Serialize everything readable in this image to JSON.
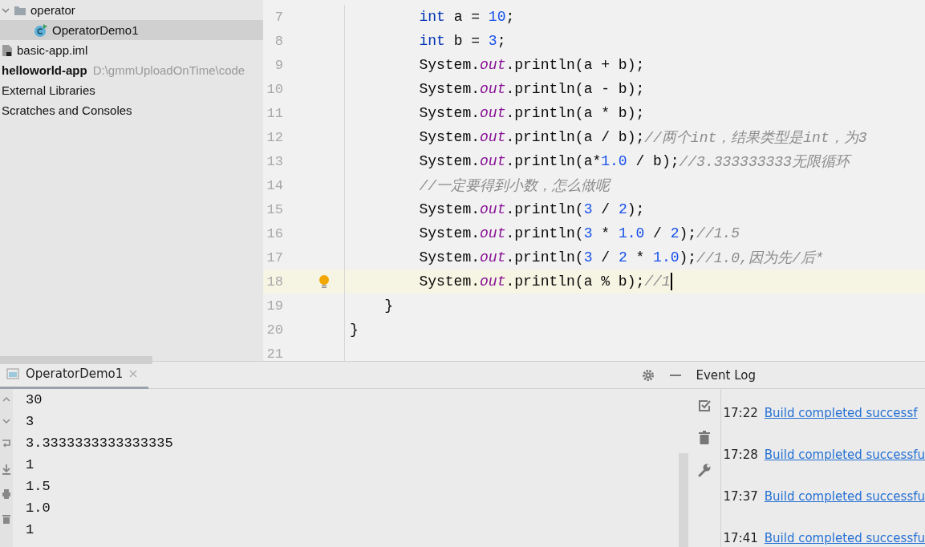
{
  "project_tree": [
    {
      "label": "operator",
      "kind": "folder",
      "expanded": true,
      "selected": false,
      "children": [
        {
          "label": "OperatorDemo1",
          "kind": "class",
          "selected": true
        }
      ]
    },
    {
      "label": "basic-app.iml",
      "kind": "file",
      "selected": false
    },
    {
      "label": "helloworld-app",
      "kind": "module",
      "bold": true,
      "path": "D:\\gmmUploadOnTime\\code",
      "selected": false
    },
    {
      "label": "External Libraries",
      "kind": "plain",
      "selected": false
    },
    {
      "label": "Scratches and Consoles",
      "kind": "plain",
      "selected": false
    }
  ],
  "editor": {
    "lines": [
      {
        "number": "7",
        "current": false,
        "tokens": [
          {
            "kind": "keyword",
            "text": "        int"
          },
          {
            "kind": "plain",
            "text": " a = "
          },
          {
            "kind": "number",
            "text": "10"
          },
          {
            "kind": "plain",
            "text": ";"
          }
        ]
      },
      {
        "number": "8",
        "current": false,
        "tokens": [
          {
            "kind": "keyword",
            "text": "        int"
          },
          {
            "kind": "plain",
            "text": " b = "
          },
          {
            "kind": "number",
            "text": "3"
          },
          {
            "kind": "plain",
            "text": ";"
          }
        ]
      },
      {
        "number": "9",
        "current": false,
        "tokens": [
          {
            "kind": "plain",
            "text": "        System."
          },
          {
            "kind": "field",
            "text": "out"
          },
          {
            "kind": "plain",
            "text": ".println(a + b);"
          }
        ]
      },
      {
        "number": "10",
        "current": false,
        "tokens": [
          {
            "kind": "plain",
            "text": "        System."
          },
          {
            "kind": "field",
            "text": "out"
          },
          {
            "kind": "plain",
            "text": ".println(a - b);"
          }
        ]
      },
      {
        "number": "11",
        "current": false,
        "tokens": [
          {
            "kind": "plain",
            "text": "        System."
          },
          {
            "kind": "field",
            "text": "out"
          },
          {
            "kind": "plain",
            "text": ".println(a * b);"
          }
        ]
      },
      {
        "number": "12",
        "current": false,
        "tokens": [
          {
            "kind": "plain",
            "text": "        System."
          },
          {
            "kind": "field",
            "text": "out"
          },
          {
            "kind": "plain",
            "text": ".println(a / b);"
          },
          {
            "kind": "comment",
            "text": "//两个int，结果类型是int，为3"
          }
        ]
      },
      {
        "number": "13",
        "current": false,
        "tokens": [
          {
            "kind": "plain",
            "text": "        System."
          },
          {
            "kind": "field",
            "text": "out"
          },
          {
            "kind": "plain",
            "text": ".println(a*"
          },
          {
            "kind": "number",
            "text": "1.0"
          },
          {
            "kind": "plain",
            "text": " / b);"
          },
          {
            "kind": "comment",
            "text": "//3.333333333无限循环"
          }
        ]
      },
      {
        "number": "14",
        "current": false,
        "tokens": [
          {
            "kind": "comment",
            "text": "        //一定要得到小数，怎么做呢"
          }
        ]
      },
      {
        "number": "15",
        "current": false,
        "tokens": [
          {
            "kind": "plain",
            "text": "        System."
          },
          {
            "kind": "field",
            "text": "out"
          },
          {
            "kind": "plain",
            "text": ".println("
          },
          {
            "kind": "number",
            "text": "3"
          },
          {
            "kind": "plain",
            "text": " / "
          },
          {
            "kind": "number",
            "text": "2"
          },
          {
            "kind": "plain",
            "text": ");"
          }
        ]
      },
      {
        "number": "16",
        "current": false,
        "tokens": [
          {
            "kind": "plain",
            "text": "        System."
          },
          {
            "kind": "field",
            "text": "out"
          },
          {
            "kind": "plain",
            "text": ".println("
          },
          {
            "kind": "number",
            "text": "3"
          },
          {
            "kind": "plain",
            "text": " * "
          },
          {
            "kind": "number",
            "text": "1.0"
          },
          {
            "kind": "plain",
            "text": " / "
          },
          {
            "kind": "number",
            "text": "2"
          },
          {
            "kind": "plain",
            "text": ");"
          },
          {
            "kind": "comment",
            "text": "//1.5"
          }
        ]
      },
      {
        "number": "17",
        "current": false,
        "tokens": [
          {
            "kind": "plain",
            "text": "        System."
          },
          {
            "kind": "field",
            "text": "out"
          },
          {
            "kind": "plain",
            "text": ".println("
          },
          {
            "kind": "number",
            "text": "3"
          },
          {
            "kind": "plain",
            "text": " / "
          },
          {
            "kind": "number",
            "text": "2"
          },
          {
            "kind": "plain",
            "text": " * "
          },
          {
            "kind": "number",
            "text": "1.0"
          },
          {
            "kind": "plain",
            "text": ");"
          },
          {
            "kind": "comment",
            "text": "//1.0,因为先/后*"
          }
        ]
      },
      {
        "number": "18",
        "current": true,
        "tokens": [
          {
            "kind": "plain",
            "text": "        System."
          },
          {
            "kind": "field",
            "text": "out"
          },
          {
            "kind": "plain",
            "text": ".println(a % b);"
          },
          {
            "kind": "comment",
            "text": "//1"
          }
        ]
      },
      {
        "number": "19",
        "current": false,
        "tokens": [
          {
            "kind": "plain",
            "text": "    }"
          }
        ]
      },
      {
        "number": "20",
        "current": false,
        "tokens": [
          {
            "kind": "plain",
            "text": "}"
          }
        ]
      },
      {
        "number": "21",
        "current": false
      }
    ]
  },
  "run_panel": {
    "tab": {
      "label": "OperatorDemo1",
      "selected": true
    },
    "output": [
      "30",
      "3",
      "3.3333333333333335",
      "1",
      "1.5",
      "1.0",
      "1"
    ]
  },
  "event_log": {
    "title": "Event Log",
    "entries": [
      {
        "time": "17:22",
        "message": "Build completed successf"
      },
      {
        "time": "17:28",
        "message": "Build completed successfu"
      },
      {
        "time": "17:37",
        "message": "Build completed successfu"
      },
      {
        "time": "17:41",
        "message": "Build completed successfu"
      }
    ]
  }
}
